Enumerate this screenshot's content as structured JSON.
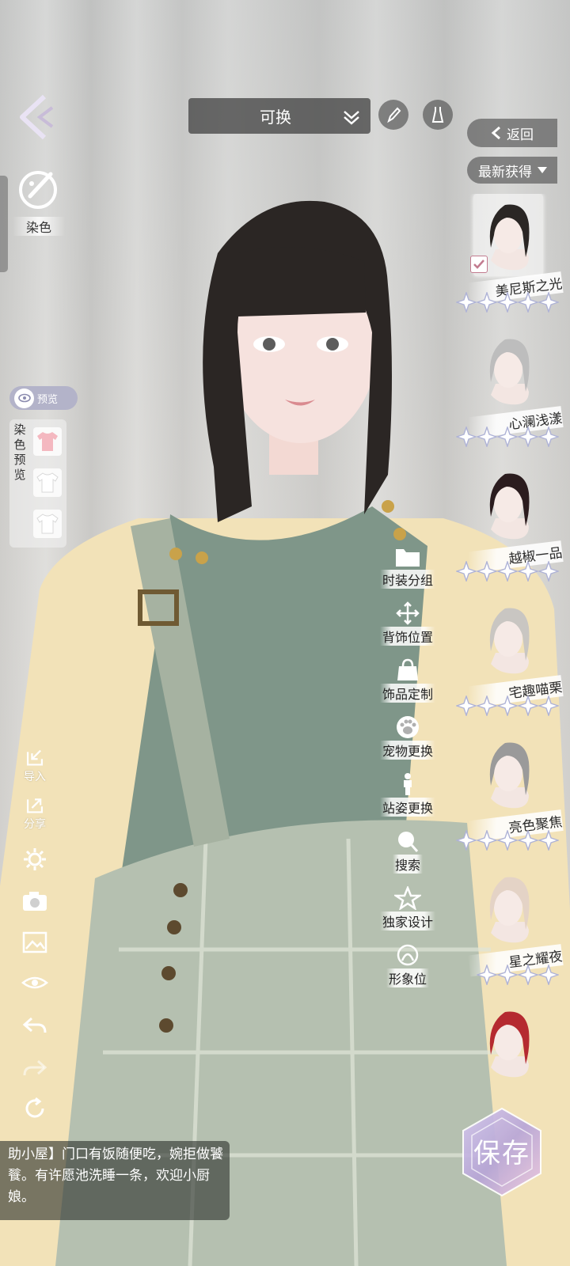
{
  "top_bar": {
    "dropdown_label": "可换"
  },
  "left_panel": {
    "dye_label": "染色",
    "preview_toggle_label": "预览",
    "dye_preview_title": "染色预览"
  },
  "left_tools": {
    "import_label": "导入",
    "share_label": "分享"
  },
  "mid_menu": {
    "items": [
      {
        "label": "时装分组"
      },
      {
        "label": "背饰位置"
      },
      {
        "label": "饰品定制"
      },
      {
        "label": "宠物更换"
      },
      {
        "label": "站姿更换"
      },
      {
        "label": "搜索"
      },
      {
        "label": "独家设计"
      },
      {
        "label": "形象位"
      }
    ]
  },
  "right_panel": {
    "return_label": "返回",
    "sort_label": "最新获得",
    "hairstyles": [
      {
        "name": "美尼斯之光",
        "stars": 5,
        "selected": true,
        "hair_color": "#2a2624"
      },
      {
        "name": "心澜浅漾",
        "stars": 5,
        "selected": false,
        "hair_color": "#bdbdbd"
      },
      {
        "name": "越椒一品",
        "stars": 5,
        "selected": false,
        "hair_color": "#2b1c1e"
      },
      {
        "name": "宅趣喵栗",
        "stars": 5,
        "selected": false,
        "hair_color": "#c9c6c2"
      },
      {
        "name": "亮色聚焦",
        "stars": 5,
        "selected": false,
        "hair_color": "#9a9a9a"
      },
      {
        "name": "星之耀夜",
        "stars": 4,
        "selected": false,
        "hair_color": "#e4d3c6"
      },
      {
        "name": "",
        "stars": 0,
        "selected": false,
        "hair_color": "#b52a30"
      }
    ]
  },
  "save_button": {
    "label": "保存"
  },
  "notice": {
    "text": "助小屋】门口有饭随便吃，婉拒做饕餮。有许愿池洗睡一条，欢迎小厨娘。"
  },
  "colors": {
    "panel_dark": "#464646",
    "toggle": "#b3b3c9",
    "save_purple": "#b8a6d8"
  }
}
